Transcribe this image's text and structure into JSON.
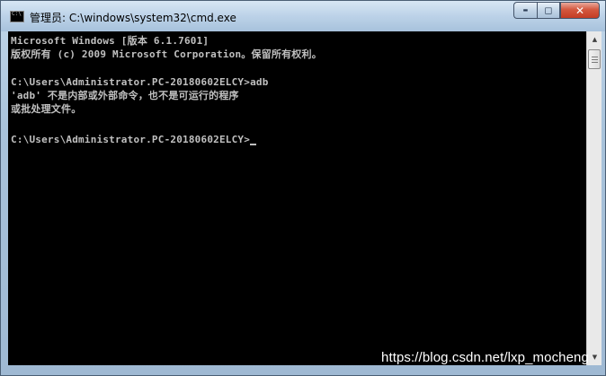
{
  "window": {
    "title": "管理员: C:\\windows\\system32\\cmd.exe",
    "icon": "cmd-icon",
    "icon_text": "C:\\"
  },
  "caption_buttons": {
    "minimize": "▬",
    "maximize": "◻",
    "close": "✕"
  },
  "console": {
    "lines": [
      "Microsoft Windows [版本 6.1.7601]",
      "版权所有 (c) 2009 Microsoft Corporation。保留所有权利。",
      "",
      "C:\\Users\\Administrator.PC-20180602ELCY>adb",
      "'adb' 不是内部或外部命令，也不是可运行的程序",
      "或批处理文件。",
      "",
      "C:\\Users\\Administrator.PC-20180602ELCY>"
    ],
    "text_color": "#c0c0c0",
    "background": "#000000"
  },
  "scrollbar": {
    "up_arrow": "▲",
    "down_arrow": "▼"
  },
  "watermark": "https://blog.csdn.net/lxp_mocheng"
}
